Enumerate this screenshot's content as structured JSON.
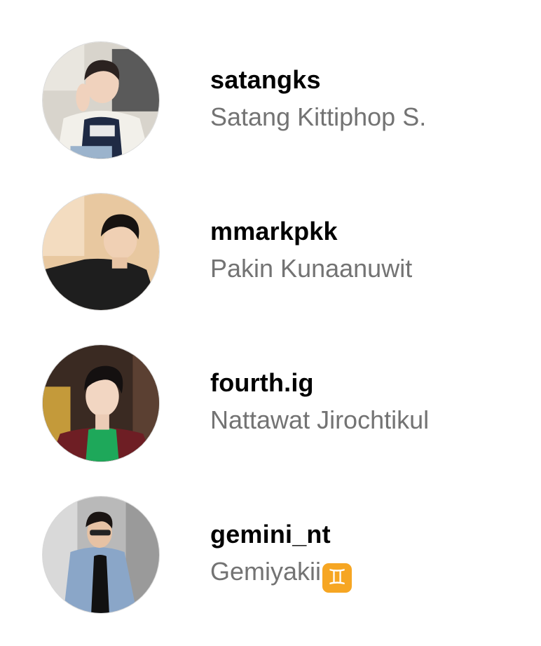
{
  "accounts": [
    {
      "username": "satangks",
      "full_name": "Satang Kittiphop S.",
      "avatar_icon": "profile-photo"
    },
    {
      "username": "mmarkpkk",
      "full_name": "Pakin Kunaanuwit",
      "avatar_icon": "profile-photo"
    },
    {
      "username": "fourth.ig",
      "full_name": "Nattawat Jirochtikul",
      "avatar_icon": "profile-photo"
    },
    {
      "username": "gemini_nt",
      "full_name": "Gemiyakii",
      "full_name_emoji": "♊",
      "avatar_icon": "profile-photo"
    }
  ],
  "colors": {
    "username": "#000000",
    "full_name": "#737373",
    "emoji_badge": "#f6a623"
  }
}
